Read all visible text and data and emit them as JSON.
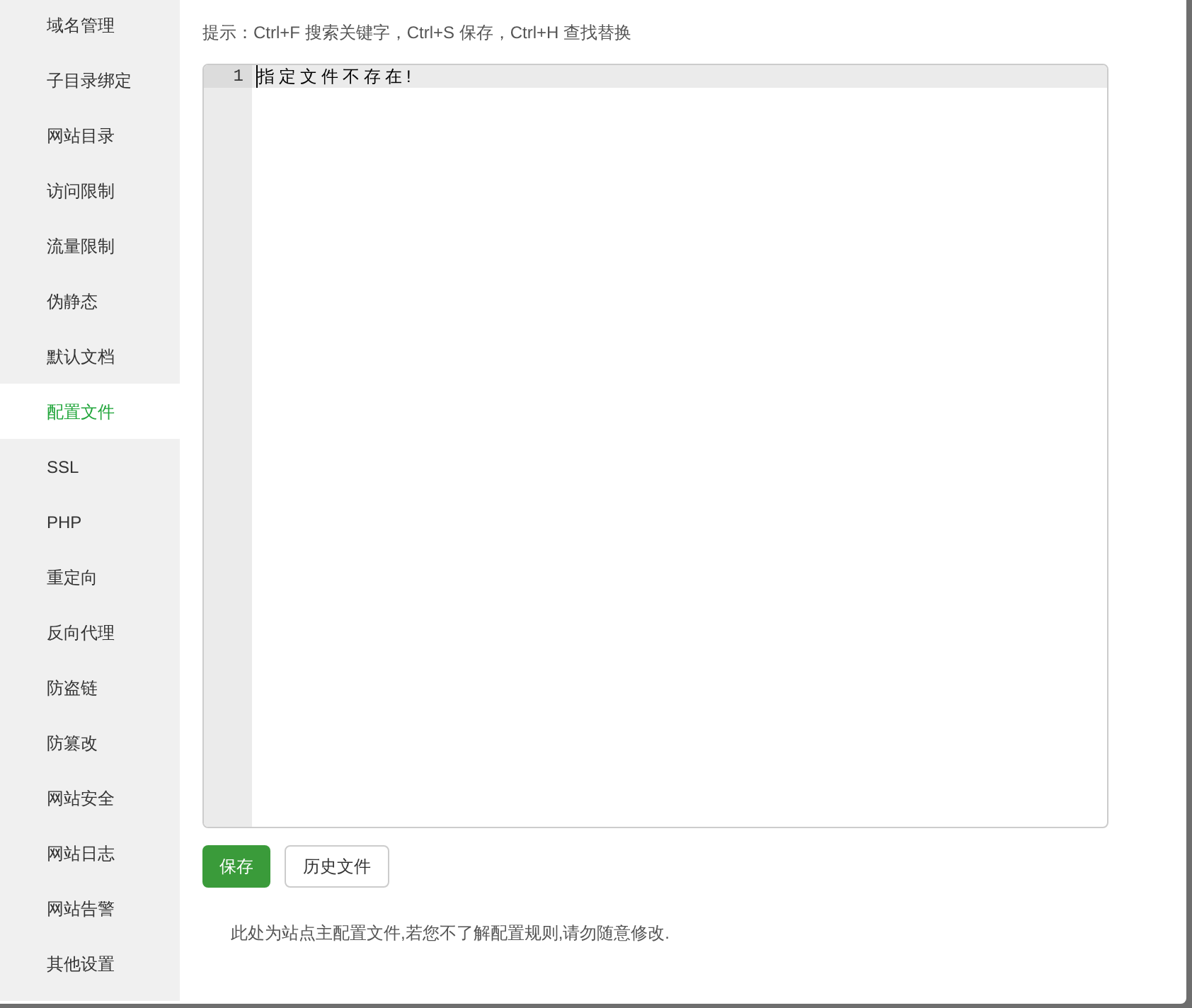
{
  "sidebar": {
    "items": [
      {
        "label": "域名管理",
        "selected": false
      },
      {
        "label": "子目录绑定",
        "selected": false
      },
      {
        "label": "网站目录",
        "selected": false
      },
      {
        "label": "访问限制",
        "selected": false
      },
      {
        "label": "流量限制",
        "selected": false
      },
      {
        "label": "伪静态",
        "selected": false
      },
      {
        "label": "默认文档",
        "selected": false
      },
      {
        "label": "配置文件",
        "selected": true
      },
      {
        "label": "SSL",
        "selected": false
      },
      {
        "label": "PHP",
        "selected": false
      },
      {
        "label": "重定向",
        "selected": false
      },
      {
        "label": "反向代理",
        "selected": false
      },
      {
        "label": "防盗链",
        "selected": false
      },
      {
        "label": "防篡改",
        "selected": false
      },
      {
        "label": "网站安全",
        "selected": false
      },
      {
        "label": "网站日志",
        "selected": false
      },
      {
        "label": "网站告警",
        "selected": false
      },
      {
        "label": "其他设置",
        "selected": false
      }
    ]
  },
  "hint": "提示：Ctrl+F 搜索关键字，Ctrl+S 保存，Ctrl+H 查找替换",
  "editor": {
    "lines": [
      {
        "number": "1",
        "text": "指定文件不存在!"
      }
    ]
  },
  "buttons": [
    {
      "label": "保存",
      "kind": "primary"
    },
    {
      "label": "历史文件",
      "kind": "default"
    }
  ],
  "note": "此处为站点主配置文件,若您不了解配置规则,请勿随意修改."
}
